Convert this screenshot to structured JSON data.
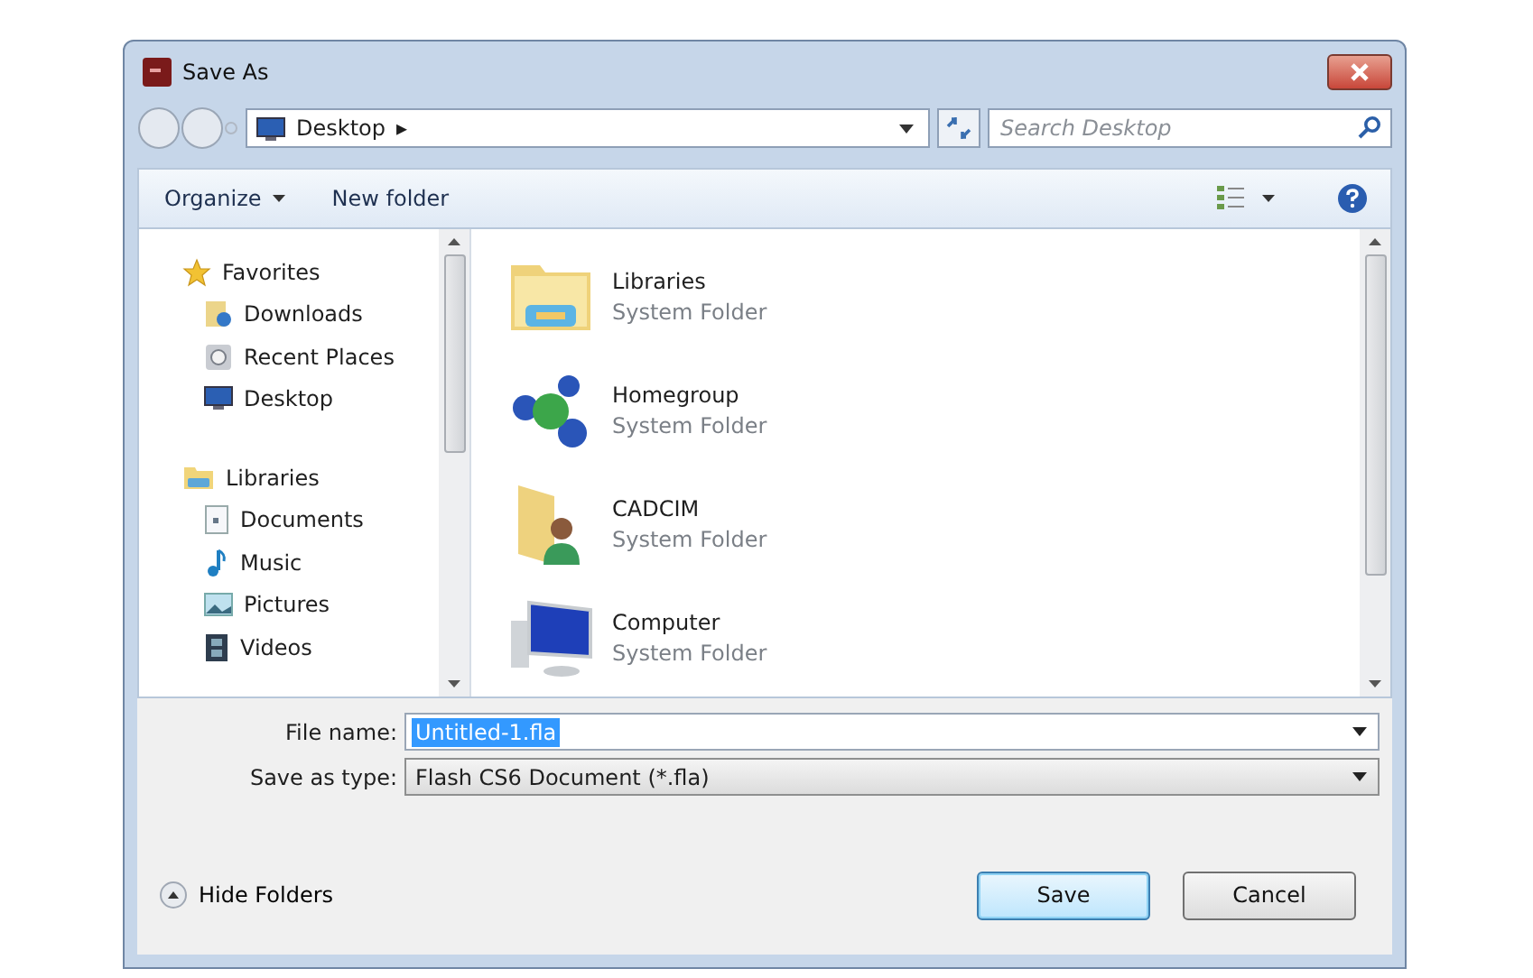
{
  "window": {
    "title": "Save As"
  },
  "address": {
    "location": "Desktop",
    "arrow": "▸"
  },
  "search": {
    "placeholder": "Search Desktop"
  },
  "toolbar": {
    "organize": "Organize",
    "new_folder": "New folder"
  },
  "sidebar": {
    "groups": [
      {
        "label": "Favorites",
        "children": [
          {
            "label": "Downloads"
          },
          {
            "label": "Recent Places"
          },
          {
            "label": "Desktop"
          }
        ]
      },
      {
        "label": "Libraries",
        "children": [
          {
            "label": "Documents"
          },
          {
            "label": "Music"
          },
          {
            "label": "Pictures"
          },
          {
            "label": "Videos"
          }
        ]
      }
    ]
  },
  "items": [
    {
      "name": "Libraries",
      "type": "System Folder"
    },
    {
      "name": "Homegroup",
      "type": "System Folder"
    },
    {
      "name": "CADCIM",
      "type": "System Folder"
    },
    {
      "name": "Computer",
      "type": "System Folder"
    }
  ],
  "file_name": {
    "label": "File name:",
    "value": "Untitled-1.fla",
    "selected": true
  },
  "save_as_type": {
    "label": "Save as type:",
    "value": "Flash CS6 Document (*.fla)"
  },
  "hide_folders": "Hide Folders",
  "buttons": [
    {
      "label": "Save",
      "default": true
    },
    {
      "label": "Cancel",
      "default": false
    }
  ]
}
